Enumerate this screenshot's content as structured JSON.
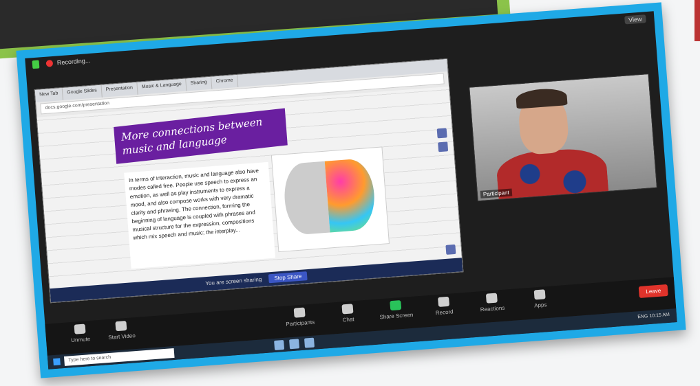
{
  "zoom": {
    "top_label": "Recording...",
    "view_label": "View",
    "end_label": "Leave",
    "tabs": [
      "New Tab",
      "Google Slides",
      "Presentation",
      "Music & Language",
      "Sharing",
      "Chrome"
    ],
    "address": "docs.google.com/presentation",
    "slide": {
      "title": "More connections between music and language",
      "body": "In terms of interaction, music and language also have modes called free. People use speech to express an emotion, as well as play instruments to express a mood, and also compose works with very dramatic clarity and phrasing. The connection, forming the beginning of language is coupled with phrases and musical structure for the expression, compositions which mix speech and music; the interplay..."
    },
    "share_bar": {
      "text": "You are screen sharing",
      "button": "Stop Share"
    },
    "participant_name": "Participant",
    "toolbar": [
      {
        "label": "Unmute"
      },
      {
        "label": "Start Video"
      },
      {
        "label": "Participants"
      },
      {
        "label": "Chat"
      },
      {
        "label": "Share Screen"
      },
      {
        "label": "Record"
      },
      {
        "label": "Reactions"
      },
      {
        "label": "Apps"
      }
    ],
    "taskbar": {
      "search_placeholder": "Type here to search",
      "tray": "ENG  10:15 AM"
    }
  },
  "colors": {
    "frame": "#1fa9e6",
    "banner": "#8bc34a",
    "purple": "#6a1fa0",
    "end": "#e0332b"
  }
}
